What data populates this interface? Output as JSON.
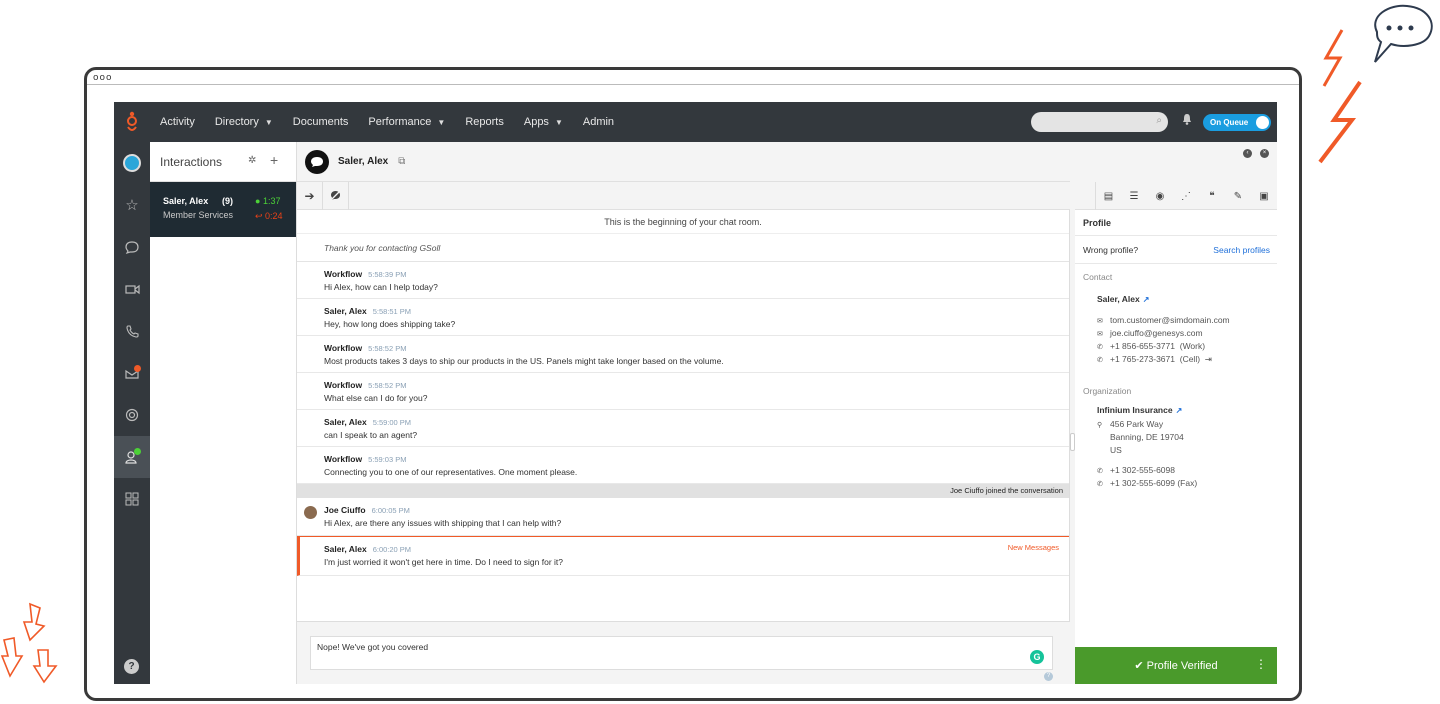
{
  "window": {
    "dots": "ooo"
  },
  "topnav": {
    "items": [
      {
        "label": "Activity",
        "caret": false
      },
      {
        "label": "Directory",
        "caret": true
      },
      {
        "label": "Documents",
        "caret": false
      },
      {
        "label": "Performance",
        "caret": true
      },
      {
        "label": "Reports",
        "caret": false
      },
      {
        "label": "Apps",
        "caret": true
      },
      {
        "label": "Admin",
        "caret": false
      }
    ],
    "queue_label": "On Queue"
  },
  "interactions": {
    "title": "Interactions",
    "card": {
      "name": "Saler, Alex",
      "count": "(9)",
      "queue": "Member Services",
      "time1": "1:37",
      "time2": "0:24"
    }
  },
  "chat": {
    "title": "Saler, Alex",
    "start": "This is the beginning of your chat room.",
    "welcome": "Thank you for contacting GSoll",
    "messages": [
      {
        "name": "Workflow",
        "time": "5:58:39 PM",
        "text": "Hi Alex, how can I help today?"
      },
      {
        "name": "Saler, Alex",
        "time": "5:58:51 PM",
        "text": "Hey, how long does shipping take?"
      },
      {
        "name": "Workflow",
        "time": "5:58:52 PM",
        "text": "Most products takes 3 days to ship our products in the US. Panels might take longer based on the volume."
      },
      {
        "name": "Workflow",
        "time": "5:58:52 PM",
        "text": "What else can I do for you?"
      },
      {
        "name": "Saler, Alex",
        "time": "5:59:00 PM",
        "text": "can I speak to an agent?"
      },
      {
        "name": "Workflow",
        "time": "5:59:03 PM",
        "text": "Connecting you to one of our representatives. One moment please."
      }
    ],
    "joined": "Joe Ciuffo joined the conversation",
    "agent_msg": {
      "name": "Joe Ciuffo",
      "time": "6:00:05 PM",
      "text": "Hi Alex, are there any issues with shipping that I can help with?"
    },
    "new_msg": {
      "name": "Saler, Alex",
      "time": "6:00:20 PM",
      "text": "I'm just worried it won't get here in time. Do I need to sign for it?"
    },
    "new_label": "New Messages",
    "compose_value": "Nope! We've got you covered"
  },
  "profile": {
    "title": "Profile",
    "wrong": "Wrong profile?",
    "search": "Search profiles",
    "contact_label": "Contact",
    "contact_name": "Saler, Alex",
    "email1": "tom.customer@simdomain.com",
    "email2": "joe.ciuffo@genesys.com",
    "phone1": "+1 856-655-3771",
    "phone1_type": "(Work)",
    "phone2": "+1 765-273-3671",
    "phone2_type": "(Cell)",
    "org_label": "Organization",
    "org_name": "Infinium Insurance",
    "addr1": "456 Park Way",
    "addr2": "Banning, DE 19704",
    "addr3": "US",
    "org_phone": "+1 302-555-6098",
    "org_fax": "+1 302-555-6099 (Fax)",
    "verified": "✔ Profile Verified"
  },
  "colors": {
    "accent_orange": "#f05a28",
    "verified_green": "#4a9a2b",
    "nav_dark": "#33383d",
    "queue_blue": "#1a9de0"
  }
}
